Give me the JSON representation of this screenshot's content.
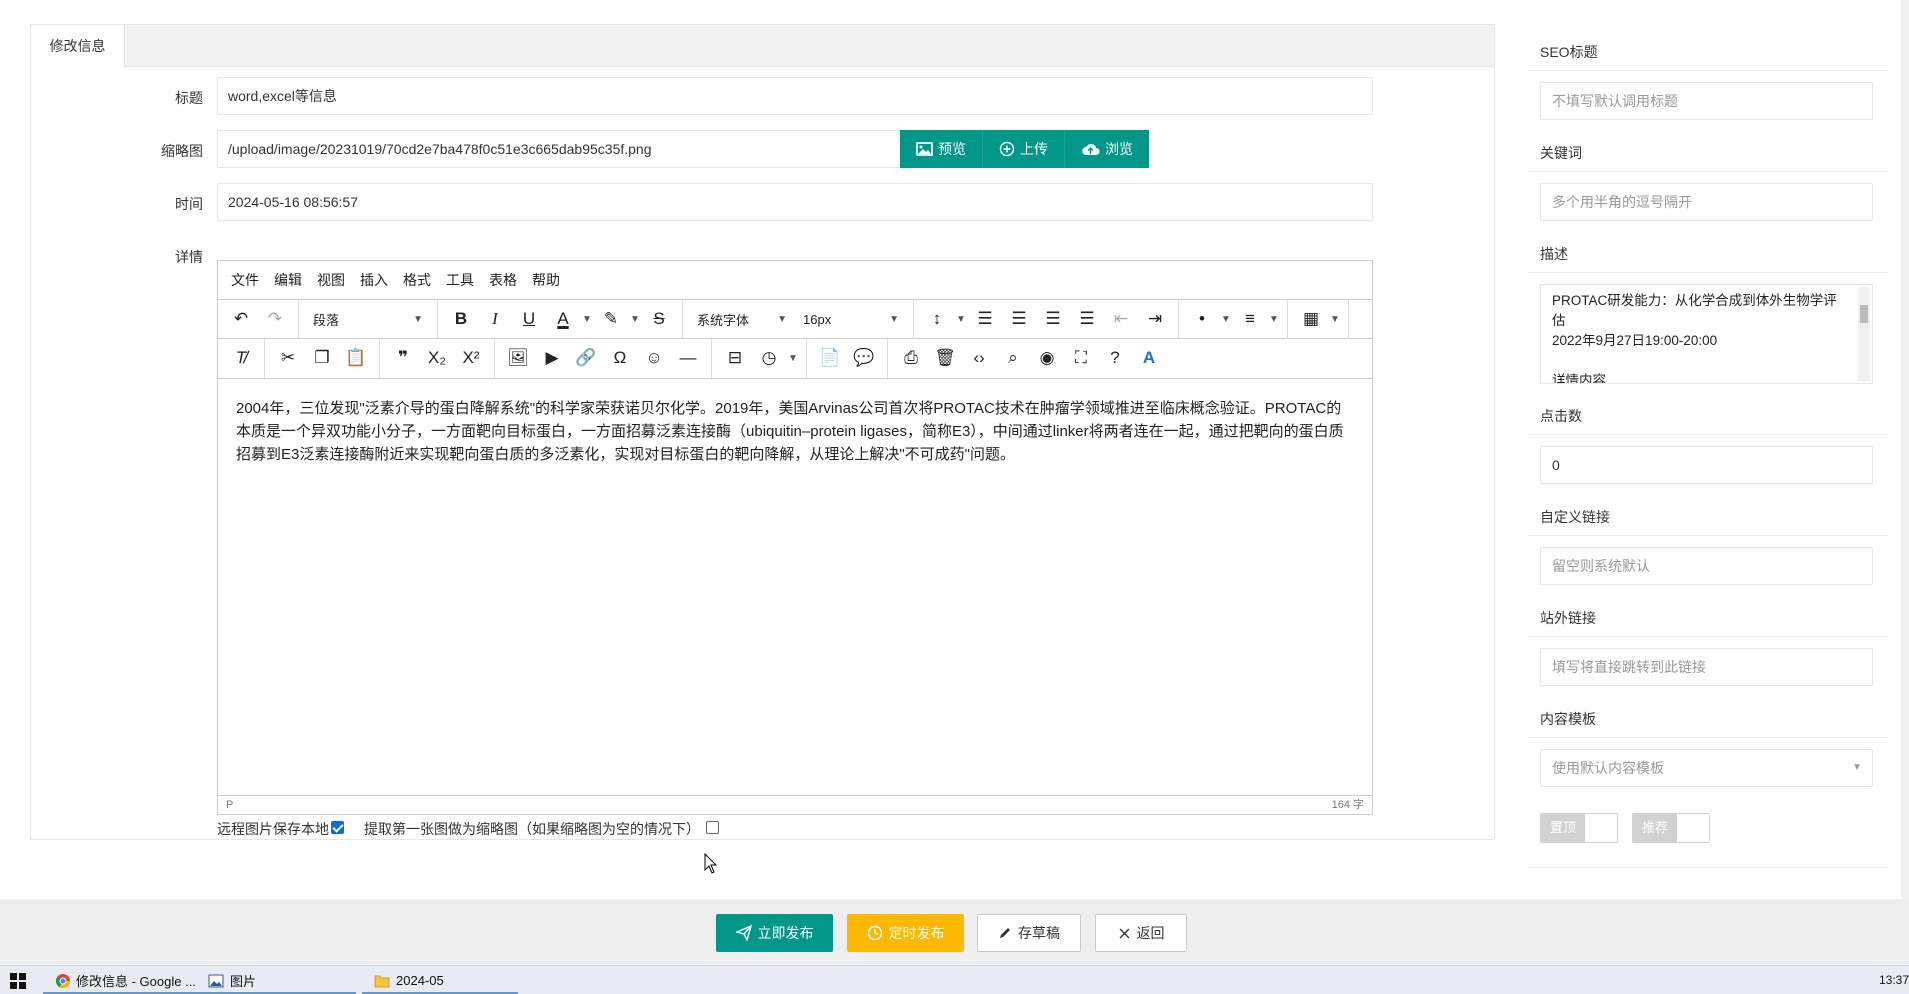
{
  "tabs": {
    "active": "修改信息"
  },
  "form": {
    "title_label": "标题",
    "title_value": "word,excel等信息",
    "thumb_label": "缩略图",
    "thumb_value": "/upload/image/20231019/70cd2e7ba478f0c51e3c665dab95c35f.png",
    "preview_label": "预览",
    "upload_label": "上传",
    "browse_label": "浏览",
    "time_label": "时间",
    "time_value": "2024-05-16 08:56:57",
    "detail_label": "详情"
  },
  "editor": {
    "menu": [
      "文件",
      "编辑",
      "视图",
      "插入",
      "格式",
      "工具",
      "表格",
      "帮助"
    ],
    "block_format": "段落",
    "font_family": "系统字体",
    "font_size": "16px",
    "content": "2004年，三位发现\"泛素介导的蛋白降解系统\"的科学家荣获诺贝尔化学。2019年，美国Arvinas公司首次将PROTAC技术在肿瘤学领域推进至临床概念验证。PROTAC的本质是一个异双功能小分子，一方面靶向目标蛋白，一方面招募泛素连接酶（ubiquitin–protein ligases，简称E3），中间通过linker将两者连在一起，通过把靶向的蛋白质招募到E3泛素连接酶附近来实现靶向蛋白质的多泛素化，实现对目标蛋白的靶向降解，从理论上解决\"不可成药\"问题。",
    "status_path": "P",
    "word_count": "164 字"
  },
  "options": {
    "remote_save_label": "远程图片保存本地",
    "remote_save_checked": true,
    "first_image_label": "提取第一张图做为缩略图（如果缩略图为空的情况下）",
    "first_image_checked": false
  },
  "right": {
    "seo_title_label": "SEO标题",
    "seo_title_placeholder": "不填写默认调用标题",
    "keywords_label": "关键词",
    "keywords_placeholder": "多个用半角的逗号隔开",
    "desc_label": "描述",
    "desc_line1": "PROTAC研发能力：从化学合成到体外生物学评估",
    "desc_line2": "2022年9月27日19:00-20:00",
    "desc_line3": "详情内容",
    "clicks_label": "点击数",
    "clicks_value": "0",
    "custom_link_label": "自定义链接",
    "custom_link_placeholder": "留空则系统默认",
    "external_link_label": "站外链接",
    "external_link_placeholder": "填写将直接跳转到此链接",
    "template_label": "内容模板",
    "template_value": "使用默认内容模板",
    "toggle_top": "置顶",
    "toggle_recommend": "推荐"
  },
  "actions": {
    "publish": "立即发布",
    "schedule": "定时发布",
    "draft": "存草稿",
    "back": "返回"
  },
  "taskbar": {
    "chrome": "修改信息 - Google ...",
    "pictures": "图片",
    "folder": "2024-05",
    "clock": "13:37"
  },
  "colors": {
    "teal": "#009688",
    "orange": "#ffb800",
    "checkbox_blue": "#0b6fe3"
  }
}
